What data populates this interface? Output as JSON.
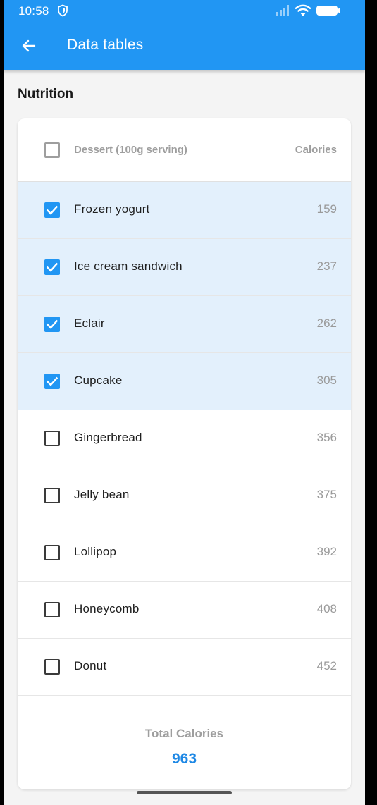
{
  "status_bar": {
    "time": "10:58",
    "icons": [
      "shield-icon",
      "signal-icon",
      "wifi-icon",
      "battery-icon"
    ]
  },
  "app_bar": {
    "title": "Data tables",
    "back_icon": "arrow-left-icon",
    "color": "#2196f3"
  },
  "section": {
    "title": "Nutrition"
  },
  "table": {
    "columns": [
      "Dessert (100g serving)",
      "Calories"
    ],
    "select_all_checked": false,
    "rows": [
      {
        "name": "Frozen yogurt",
        "calories": "159",
        "selected": true
      },
      {
        "name": "Ice cream sandwich",
        "calories": "237",
        "selected": true
      },
      {
        "name": "Eclair",
        "calories": "262",
        "selected": true
      },
      {
        "name": "Cupcake",
        "calories": "305",
        "selected": true
      },
      {
        "name": "Gingerbread",
        "calories": "356",
        "selected": false
      },
      {
        "name": "Jelly bean",
        "calories": "375",
        "selected": false
      },
      {
        "name": "Lollipop",
        "calories": "392",
        "selected": false
      },
      {
        "name": "Honeycomb",
        "calories": "408",
        "selected": false
      },
      {
        "name": "Donut",
        "calories": "452",
        "selected": false
      }
    ],
    "selected_row_color": "#e3f0fc",
    "checkbox_color": "#2196f3"
  },
  "footer": {
    "total_label": "Total Calories",
    "total_value": "963",
    "total_color": "#1e88e5"
  }
}
